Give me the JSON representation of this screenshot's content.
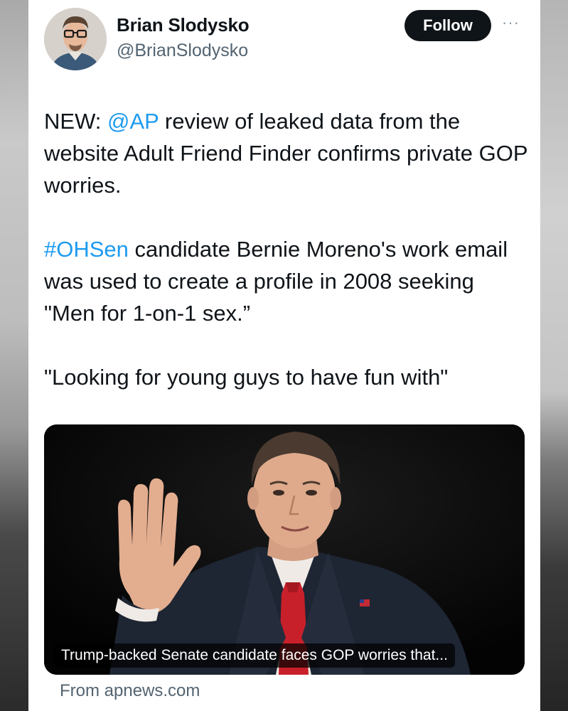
{
  "author": {
    "display_name": "Brian Slodysko",
    "handle": "@BrianSlodysko",
    "avatar": "profile-photo"
  },
  "actions": {
    "follow_label": "Follow",
    "more_icon": "more-horizontal-icon"
  },
  "tweet": {
    "p1": {
      "pre": "NEW: ",
      "mention": "@AP",
      "post": " review of leaked data from the website Adult Friend Finder confirms private GOP worries."
    },
    "p2": {
      "hashtag": "#OHSen",
      "post": " candidate Bernie Moreno's work email was used to create a profile in 2008 seeking \"Men for 1-on-1 sex.”"
    },
    "p3": "\"Looking for young guys to have fun with\""
  },
  "card": {
    "image": "news-photo",
    "caption": "Trump-backed Senate candidate faces GOP worries that...",
    "source": "From apnews.com"
  },
  "colors": {
    "link": "#1d9bf0",
    "text": "#0f1419",
    "secondary": "#536471",
    "follow_bg": "#0f1419"
  }
}
